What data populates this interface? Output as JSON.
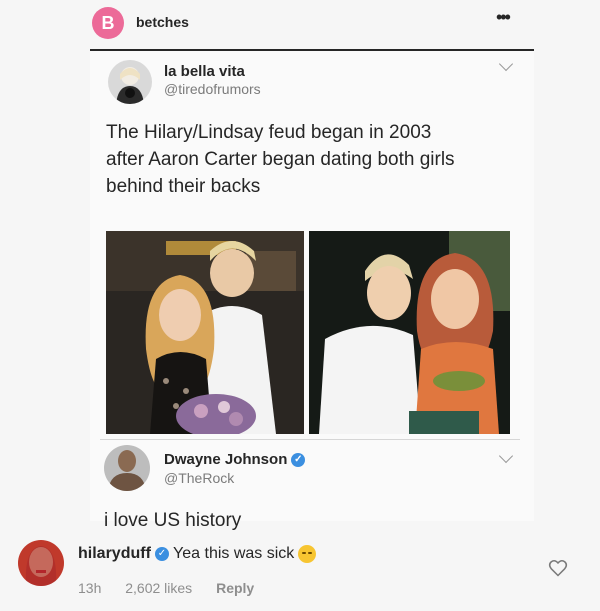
{
  "post": {
    "account_name": "betches",
    "avatar_letter": "B",
    "more_icon": "more-dots-icon",
    "brand_color": "#ec6a98"
  },
  "tweet": {
    "name": "la bella vita",
    "handle": "@tiredofrumors",
    "text_lines": [
      "The Hilary/Lindsay feud began in 2003",
      "after Aaron Carter began dating both girls",
      "behind their backs"
    ]
  },
  "quote_tweet": {
    "name": "Dwayne Johnson",
    "handle": "@TheRock",
    "verified": true,
    "text": "i love US history"
  },
  "comment": {
    "username": "hilaryduff",
    "verified": true,
    "text": "Yea this was sick",
    "emoji": "unamused-face-emoji",
    "time": "13h",
    "likes": "2,602 likes",
    "reply_label": "Reply",
    "like_icon": "heart-icon"
  },
  "colors": {
    "verified_blue": "#3b8fe0",
    "muted_text": "#8e8e8e"
  }
}
